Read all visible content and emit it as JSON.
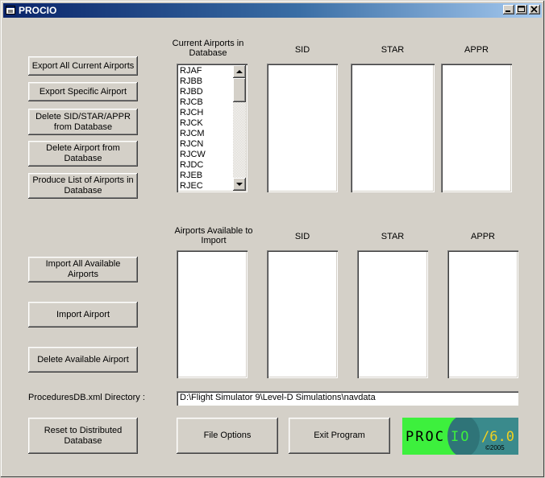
{
  "window": {
    "title": "PROCIO"
  },
  "buttons": {
    "export_all": "Export All Current Airports",
    "export_specific": "Export Specific Airport",
    "delete_procedures": "Delete SID/STAR/APPR from Database",
    "delete_airport": "Delete Airport from Database",
    "produce_list": "Produce List of Airports in Database",
    "import_all": "Import All Available Airports",
    "import_airport": "Import Airport",
    "delete_available": "Delete Available Airport",
    "reset_db": "Reset to Distributed Database",
    "file_options": "File Options",
    "exit_program": "Exit Program"
  },
  "current_section": {
    "airports_header": "Current Airports in Database",
    "sid_header": "SID",
    "star_header": "STAR",
    "appr_header": "APPR",
    "airports": [
      "RJAF",
      "RJBB",
      "RJBD",
      "RJCB",
      "RJCH",
      "RJCK",
      "RJCM",
      "RJCN",
      "RJCW",
      "RJDC",
      "RJEB",
      "RJEC"
    ]
  },
  "available_section": {
    "airports_header": "Airports Available to Import",
    "sid_header": "SID",
    "star_header": "STAR",
    "appr_header": "APPR"
  },
  "directory": {
    "label": "ProceduresDB.xml Directory :",
    "value": "D:\\Flight Simulator 9\\Level-D Simulations\\navdata"
  },
  "logo": {
    "text_left": "PROC",
    "text_mid": "IO",
    "text_right": "/6.0",
    "copyright": "©2005",
    "colors": {
      "green": "#3df03d",
      "teal": "#3a8a8c",
      "teal_dark": "#2f7478",
      "text_yellow": "#f0d020"
    }
  }
}
